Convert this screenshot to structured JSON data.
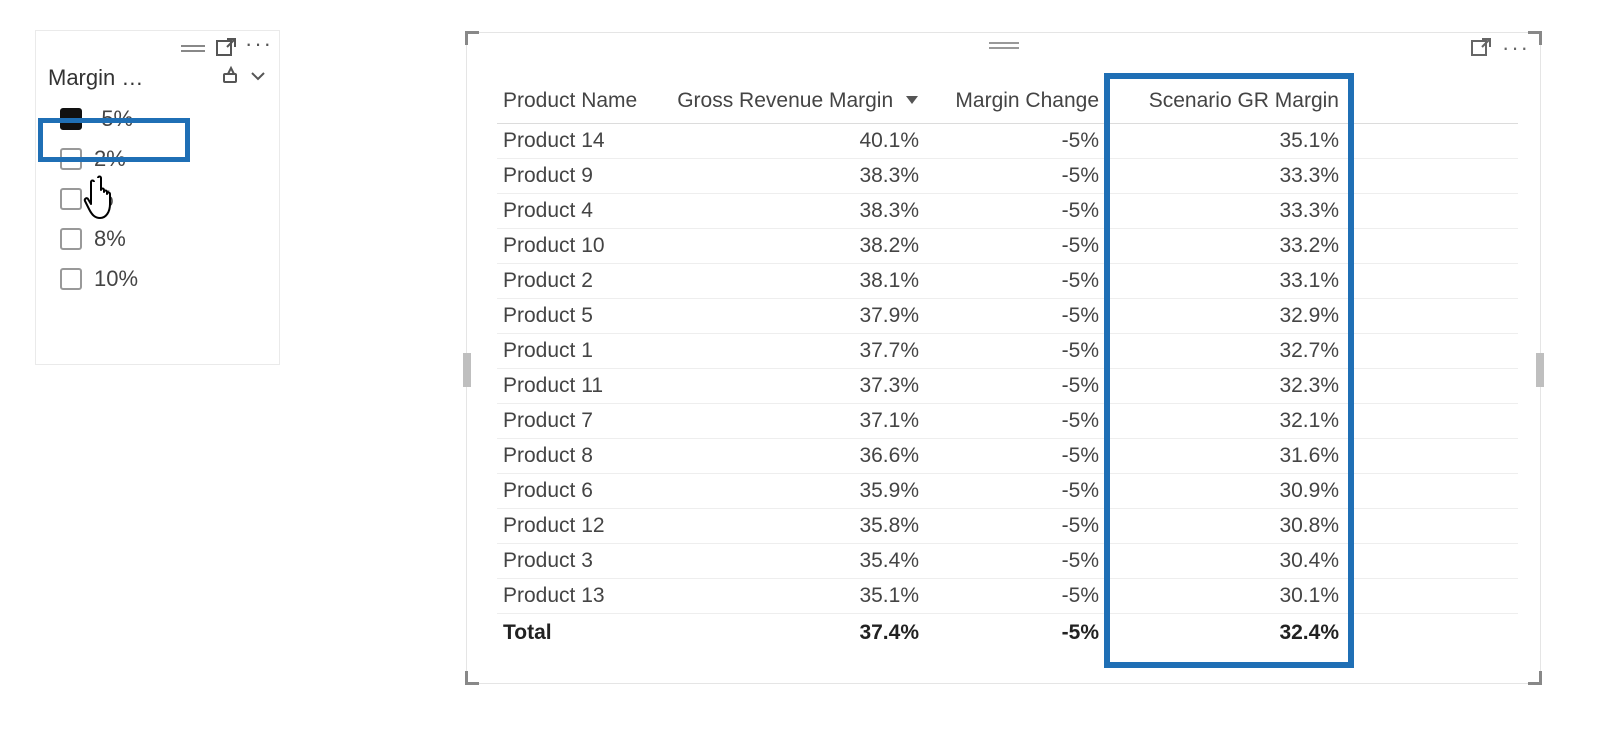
{
  "slicer": {
    "title": "Margin …",
    "items": [
      {
        "label": "-5%",
        "selected": true
      },
      {
        "label": "2%",
        "selected": false
      },
      {
        "label": "%",
        "selected": false
      },
      {
        "label": "8%",
        "selected": false
      },
      {
        "label": "10%",
        "selected": false
      }
    ]
  },
  "table": {
    "columns": {
      "product": "Product Name",
      "grm": "Gross Revenue Margin",
      "mc": "Margin Change",
      "sgr": "Scenario GR Margin"
    },
    "rows": [
      {
        "product": "Product 14",
        "grm": "40.1%",
        "mc": "-5%",
        "sgr": "35.1%"
      },
      {
        "product": "Product 9",
        "grm": "38.3%",
        "mc": "-5%",
        "sgr": "33.3%"
      },
      {
        "product": "Product 4",
        "grm": "38.3%",
        "mc": "-5%",
        "sgr": "33.3%"
      },
      {
        "product": "Product 10",
        "grm": "38.2%",
        "mc": "-5%",
        "sgr": "33.2%"
      },
      {
        "product": "Product 2",
        "grm": "38.1%",
        "mc": "-5%",
        "sgr": "33.1%"
      },
      {
        "product": "Product 5",
        "grm": "37.9%",
        "mc": "-5%",
        "sgr": "32.9%"
      },
      {
        "product": "Product 1",
        "grm": "37.7%",
        "mc": "-5%",
        "sgr": "32.7%"
      },
      {
        "product": "Product 11",
        "grm": "37.3%",
        "mc": "-5%",
        "sgr": "32.3%"
      },
      {
        "product": "Product 7",
        "grm": "37.1%",
        "mc": "-5%",
        "sgr": "32.1%"
      },
      {
        "product": "Product 8",
        "grm": "36.6%",
        "mc": "-5%",
        "sgr": "31.6%"
      },
      {
        "product": "Product 6",
        "grm": "35.9%",
        "mc": "-5%",
        "sgr": "30.9%"
      },
      {
        "product": "Product 12",
        "grm": "35.8%",
        "mc": "-5%",
        "sgr": "30.8%"
      },
      {
        "product": "Product 3",
        "grm": "35.4%",
        "mc": "-5%",
        "sgr": "30.4%"
      },
      {
        "product": "Product 13",
        "grm": "35.1%",
        "mc": "-5%",
        "sgr": "30.1%"
      }
    ],
    "total": {
      "label": "Total",
      "grm": "37.4%",
      "mc": "-5%",
      "sgr": "32.4%"
    }
  }
}
